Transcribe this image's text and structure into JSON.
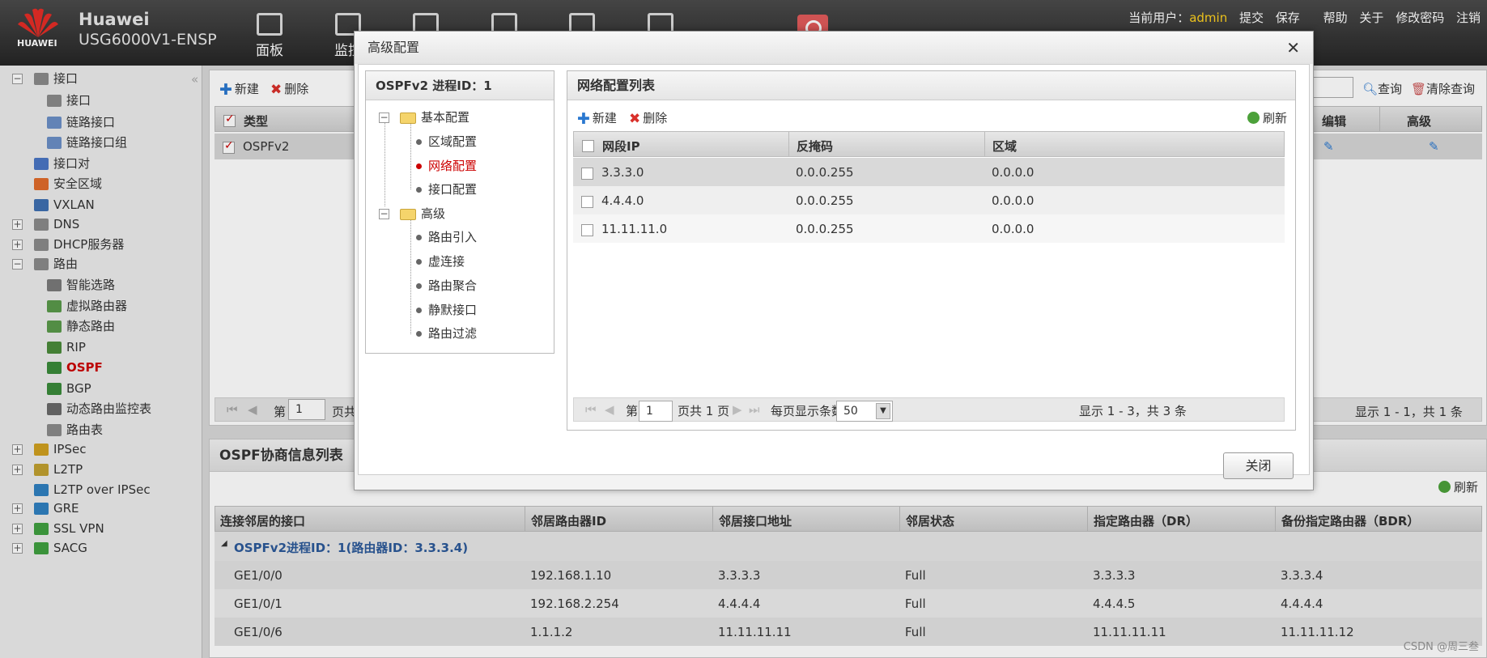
{
  "header": {
    "logo_text": "HUAWEI",
    "brand_line1": "Huawei",
    "brand_line2": "USG6000V1-ENSP",
    "tabs": [
      {
        "label": "面板",
        "icon": "dashboard-icon"
      },
      {
        "label": "监控",
        "icon": "monitor-icon"
      },
      {
        "label": "",
        "icon": "policy-icon"
      },
      {
        "label": "",
        "icon": "object-icon"
      },
      {
        "label": "",
        "icon": "network-icon"
      },
      {
        "label": "",
        "icon": "system-icon"
      }
    ],
    "current_user_label": "当前用户：",
    "current_user": "admin",
    "links": [
      "提交",
      "保存",
      "帮助",
      "关于",
      "修改密码",
      "注销"
    ]
  },
  "sidebar": {
    "items": [
      {
        "label": "接口",
        "level": 0,
        "icon": "interface-icon",
        "expander": "−"
      },
      {
        "label": "接口",
        "level": 1,
        "icon": "interface-icon"
      },
      {
        "label": "链路接口",
        "level": 1,
        "icon": "link-icon"
      },
      {
        "label": "链路接口组",
        "level": 1,
        "icon": "link-group-icon"
      },
      {
        "label": "接口对",
        "level": 0,
        "icon": "interface-pair-icon"
      },
      {
        "label": "安全区域",
        "level": 0,
        "icon": "security-zone-icon"
      },
      {
        "label": "VXLAN",
        "level": 0,
        "icon": "vxlan-icon"
      },
      {
        "label": "DNS",
        "level": 0,
        "icon": "dns-icon",
        "expander": "+"
      },
      {
        "label": "DHCP服务器",
        "level": 0,
        "icon": "dhcp-icon",
        "expander": "+"
      },
      {
        "label": "路由",
        "level": 0,
        "icon": "route-icon",
        "expander": "−"
      },
      {
        "label": "智能选路",
        "level": 1,
        "icon": "smart-route-icon"
      },
      {
        "label": "虚拟路由器",
        "level": 1,
        "icon": "virtual-router-icon"
      },
      {
        "label": "静态路由",
        "level": 1,
        "icon": "static-route-icon"
      },
      {
        "label": "RIP",
        "level": 1,
        "icon": "rip-icon"
      },
      {
        "label": "OSPF",
        "level": 1,
        "icon": "ospf-icon",
        "active": true
      },
      {
        "label": "BGP",
        "level": 1,
        "icon": "bgp-icon"
      },
      {
        "label": "动态路由监控表",
        "level": 1,
        "icon": "route-monitor-icon"
      },
      {
        "label": "路由表",
        "level": 1,
        "icon": "route-table-icon"
      },
      {
        "label": "IPSec",
        "level": 0,
        "icon": "ipsec-icon",
        "expander": "+"
      },
      {
        "label": "L2TP",
        "level": 0,
        "icon": "l2tp-icon",
        "expander": "+"
      },
      {
        "label": "L2TP over IPSec",
        "level": 0,
        "icon": "l2tp-ipsec-icon"
      },
      {
        "label": "GRE",
        "level": 0,
        "icon": "gre-icon",
        "expander": "+"
      },
      {
        "label": "SSL VPN",
        "level": 0,
        "icon": "ssl-vpn-icon",
        "expander": "+"
      },
      {
        "label": "SACG",
        "level": 0,
        "icon": "sacg-icon",
        "expander": "+"
      }
    ]
  },
  "main": {
    "new_label": "新建",
    "delete_label": "删除",
    "query_label": "查询",
    "clear_query_label": "清除查询",
    "col_type": "类型",
    "col_edit": "编辑",
    "col_advanced": "高级",
    "row_type": "OSPFv2",
    "pager_page_prefix": "第",
    "pager_page_value": "1",
    "pager_page_suffix": "页共",
    "pager_info": "显示 1 - 1，共 1 条"
  },
  "neighbors": {
    "title": "OSPF协商信息列表",
    "refresh_label": "刷新",
    "columns": [
      "连接邻居的接口",
      "邻居路由器ID",
      "邻居接口地址",
      "邻居状态",
      "指定路由器（DR）",
      "备份指定路由器（BDR）"
    ],
    "group_label": "OSPFv2进程ID：1(路由器ID：3.3.3.4)",
    "rows": [
      [
        "GE1/0/0",
        "192.168.1.10",
        "3.3.3.3",
        "Full",
        "3.3.3.3",
        "3.3.3.4"
      ],
      [
        "GE1/0/1",
        "192.168.2.254",
        "4.4.4.4",
        "Full",
        "4.4.4.5",
        "4.4.4.4"
      ],
      [
        "GE1/0/6",
        "1.1.1.2",
        "11.11.11.11",
        "Full",
        "11.11.11.11",
        "11.11.11.12"
      ]
    ]
  },
  "modal": {
    "title": "高级配置",
    "close_label": "关闭",
    "tree_title": "OSPFv2 进程ID：1",
    "tree": {
      "basic": "基本配置",
      "basic_children": [
        "区域配置",
        "网络配置",
        "接口配置"
      ],
      "advanced": "高级",
      "advanced_children": [
        "路由引入",
        "虚连接",
        "路由聚合",
        "静默接口",
        "路由过滤"
      ]
    },
    "list_title": "网络配置列表",
    "new_label": "新建",
    "delete_label": "删除",
    "refresh_label": "刷新",
    "columns": [
      "网段IP",
      "反掩码",
      "区域"
    ],
    "rows": [
      [
        "3.3.3.0",
        "0.0.0.255",
        "0.0.0.0"
      ],
      [
        "4.4.4.0",
        "0.0.0.255",
        "0.0.0.0"
      ],
      [
        "11.11.11.0",
        "0.0.0.255",
        "0.0.0.0"
      ]
    ],
    "pager": {
      "page_prefix": "第",
      "page_value": "1",
      "page_suffix": "页共 1 页",
      "per_page_label": "每页显示条数",
      "per_page_value": "50",
      "info": "显示 1 - 3，共 3 条"
    }
  },
  "watermark": "CSDN @周三叁"
}
